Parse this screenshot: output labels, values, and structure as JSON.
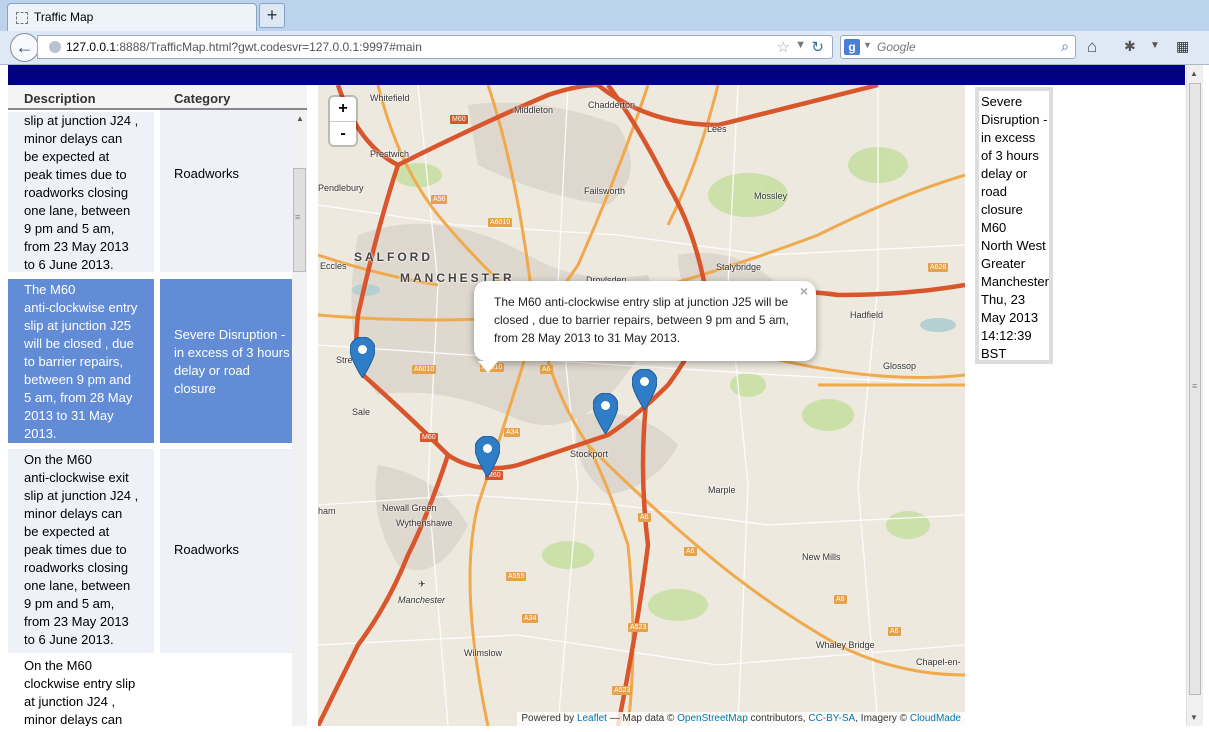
{
  "browser": {
    "tab_title": "Traffic Map",
    "new_tab_label": "+",
    "url_host": "127.0.0.1",
    "url_rest": ":8888/TrafficMap.html?gwt.codesvr=127.0.0.1:9997#main",
    "search_engine_label": "g",
    "search_placeholder": "Google"
  },
  "table": {
    "headers": {
      "description": "Description",
      "category": "Category"
    },
    "rows": [
      {
        "desc": [
          "slip at junction J24 ,",
          "minor delays can",
          "be expected at",
          "peak times due to",
          "roadworks closing",
          "one lane, between",
          "9 pm and 5 am,",
          "from 23 May 2013",
          "to 6 June 2013."
        ],
        "category": [
          "Roadworks"
        ],
        "selected": false
      },
      {
        "desc": [
          "The M60",
          "anti-clockwise entry",
          "slip at junction J25",
          "will be closed , due",
          "to barrier repairs,",
          "between 9 pm and",
          "5 am, from 28 May",
          "2013 to 31 May",
          "2013."
        ],
        "category": [
          "Severe Disruption -",
          "in excess of 3 hours",
          "delay or road",
          "closure"
        ],
        "selected": true
      },
      {
        "desc": [
          "On the M60",
          "anti-clockwise exit",
          "slip at junction J24 ,",
          "minor delays can",
          "be expected at",
          "peak times due to",
          "roadworks closing",
          "one lane, between",
          "9 pm and 5 am,",
          "from 23 May 2013",
          "to 6 June 2013."
        ],
        "category": [
          "Roadworks"
        ],
        "selected": false
      },
      {
        "desc": [
          "On the M60",
          "clockwise entry slip",
          "at junction J24 ,",
          "minor delays can"
        ],
        "category": [],
        "selected": false
      }
    ]
  },
  "map": {
    "zoom_in": "+",
    "zoom_out": "-",
    "popup_text": "The M60 anti-clockwise entry slip at junction J25 will be closed , due to barrier repairs, between 9 pm and 5 am, from 28 May 2013 to 31 May 2013.",
    "popup_close": "×",
    "attribution": {
      "powered": "Powered by",
      "leaflet": "Leaflet",
      "mapdata": "— Map data ©",
      "osm": "OpenStreetMap",
      "contrib": "contributors,",
      "license": "CC-BY-SA",
      "imagery": ", Imagery ©",
      "cloudmade": "CloudMade"
    },
    "places": {
      "whitefield": "Whitefield",
      "middleton": "Middleton",
      "chadderton": "Chadderton",
      "prestwich": "Prestwich",
      "lees": "Lees",
      "pendlebury": "Pendlebury",
      "failsworth": "Failsworth",
      "mossley": "Mossley",
      "salford": "SALFORD",
      "manchester_big": "MANCHESTER",
      "eccles": "Eccles",
      "droylsden": "Droylsden",
      "stalybridge": "Stalybridge",
      "hadfield": "Hadfield",
      "stretford": "Stretford",
      "glossop": "Glossop",
      "sale": "Sale",
      "stockport": "Stockport",
      "marple": "Marple",
      "newall_green": "Newall Green",
      "wythenshawe": "Wythenshawe",
      "new_mills": "New Mills",
      "manchester_airport": "Manchester",
      "whaley_bridge": "Whaley Bridge",
      "wilmslow": "Wilmslow",
      "chapel": "Chapel-en-",
      "ham": "ham"
    },
    "roads": {
      "m60_a": "M60",
      "m60_b": "M60",
      "m60_c": "M60",
      "a56": "A56",
      "a6010_a": "A6010",
      "a6010_b": "A6010",
      "a6010_c": "A6010",
      "a6_a": "A6",
      "a6_b": "A6",
      "a6_c": "A6",
      "a6_d": "A6",
      "a6_e": "A6",
      "a34_a": "A34",
      "a34_b": "A34",
      "a555": "A555",
      "a523_a": "A523",
      "a523_b": "A523",
      "a628": "A628"
    }
  },
  "detail": {
    "lines": [
      "Severe",
      "Disruption -",
      "in excess",
      "of 3 hours",
      "delay or",
      "road",
      "closure",
      "M60",
      "North West",
      "Greater",
      "Manchester",
      "Thu, 23",
      "May 2013",
      "14:12:39",
      "BST"
    ]
  },
  "colors": {
    "header_bar": "#000080",
    "selected_row": "#628cd5",
    "marker": "#2e7dc6"
  }
}
